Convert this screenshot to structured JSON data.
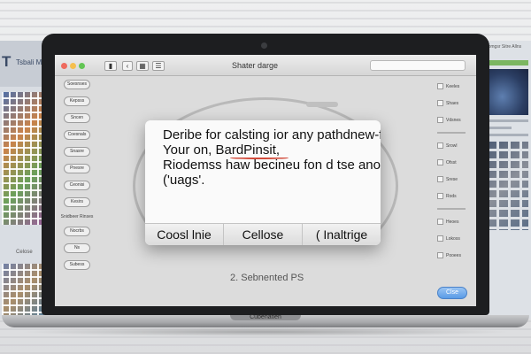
{
  "background": {
    "left_window": {
      "title": "T",
      "subtitle": "Tsbali M",
      "mid_label": "Celose"
    },
    "right_window": {
      "top_text": "Uomgsr Sitre Allns"
    }
  },
  "window": {
    "title": "Shater darge"
  },
  "left_sidebar": {
    "items": [
      "Soesnses",
      "Kepsss",
      "Sncen",
      "Coesnals",
      "Snasre",
      "Pnesre",
      "Ceonisi",
      "Kesirs"
    ],
    "group_label": "Snidbeer Rinses",
    "bottom_items": [
      "Nocrbs",
      "Ns",
      "Subess"
    ]
  },
  "right_sidebar": {
    "items": [
      "Keeles",
      "Shaes",
      "Vdsnes",
      "Srowl",
      "Ofsst",
      "Srese",
      "Rods",
      "Heoes",
      "Lokoss",
      "Pooees"
    ]
  },
  "dialog": {
    "lines": [
      "Deribe for calsting ior any pathdnew-fioxt.",
      "Your on, BardPinsit,",
      "Riodemss haw becineu fon d tse anomt",
      "('uags'."
    ],
    "buttons": [
      "Coosl lnie",
      "Cellose",
      "( Inaltrige"
    ]
  },
  "caption": "2. Sebnented PS",
  "done_button": "Clse",
  "laptop_label": "Cubenatien",
  "colors": {
    "close": "#ee6a5e",
    "minimize": "#f5bf4f",
    "zoom": "#62c554",
    "spell_underline": "#d24a3a",
    "accent_button": "#5a9be6"
  }
}
